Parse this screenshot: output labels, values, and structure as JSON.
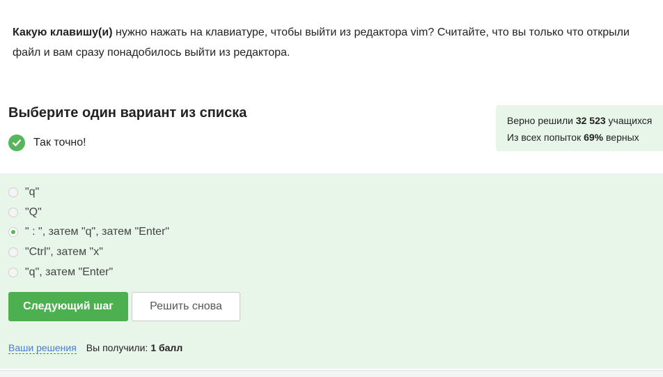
{
  "question": {
    "bold": "Какую клавишу(и)",
    "rest_line1": " нужно нажать на клавиатуре, чтобы выйти из редактора vim? Считайте, что вы только что открыли",
    "line2": "файл и вам сразу понадобилось выйти из редактора."
  },
  "choose_title": "Выберите один вариант из списка",
  "result": {
    "text": "Так точно!",
    "icon": "check-circle-icon",
    "color": "#57b65c"
  },
  "stats": {
    "solved_prefix": "Верно решили",
    "solved_count": "32 523",
    "solved_suffix": "учащихся",
    "attempts_prefix": "Из всех попыток",
    "attempts_percent": "69%",
    "attempts_suffix": "верных"
  },
  "options": [
    {
      "label": "\"q\"",
      "selected": false
    },
    {
      "label": "\"Q\"",
      "selected": false
    },
    {
      "label": "\" : \", затем \"q\", затем \"Enter\"",
      "selected": true
    },
    {
      "label": "\"Ctrl\", затем \"x\"",
      "selected": false
    },
    {
      "label": "\"q\", затем \"Enter\"",
      "selected": false
    }
  ],
  "buttons": {
    "next": "Следующий шаг",
    "retry": "Решить снова"
  },
  "footer": {
    "solutions_link": "Ваши решения",
    "score_label": "Вы получили:",
    "score_value": "1 балл"
  },
  "colors": {
    "accent": "#4caf50",
    "panel_bg": "#e8f5e9",
    "link": "#4a7bd0"
  }
}
